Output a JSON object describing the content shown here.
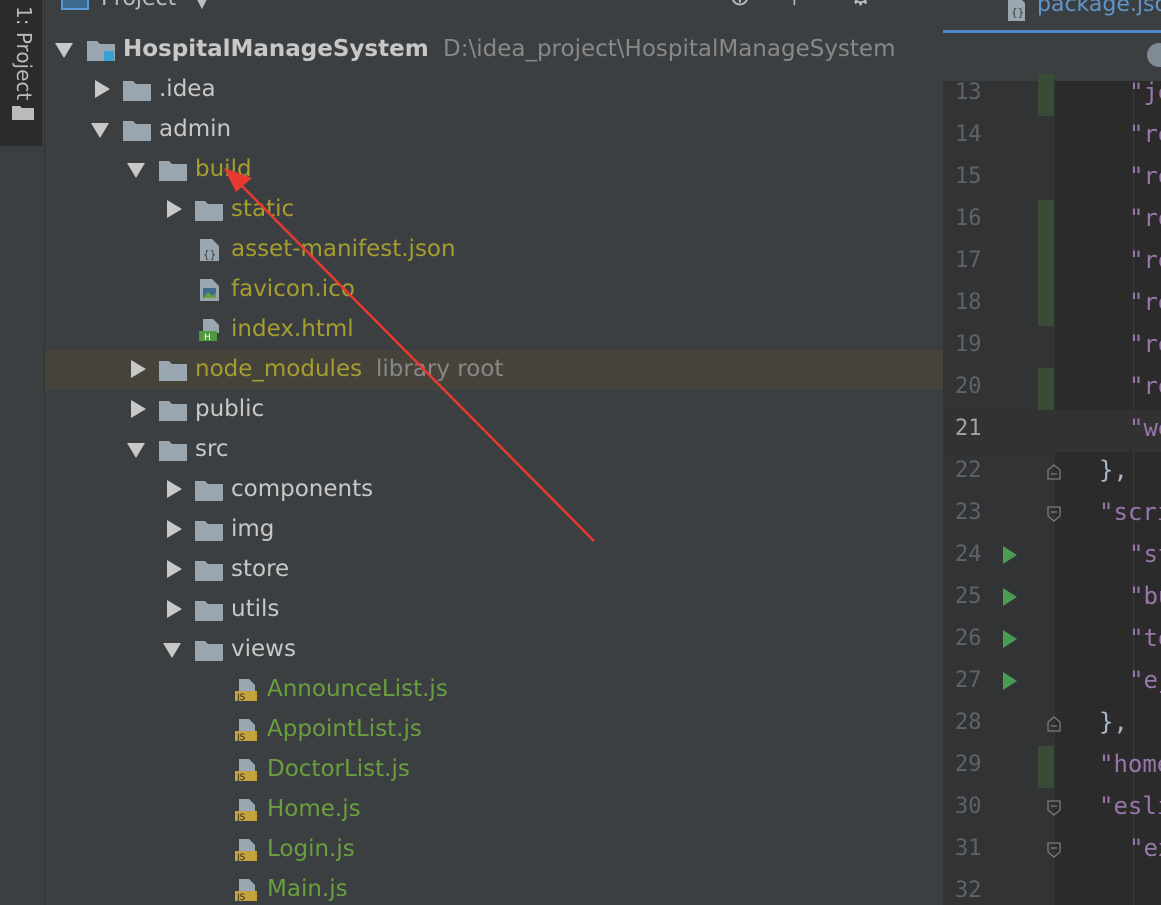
{
  "sidebar": {
    "tool_window_label": "1: Project"
  },
  "project_panel": {
    "title": "Project",
    "tree": [
      {
        "label": "HospitalManageSystem",
        "hint": "D:\\idea_project\\HospitalManageSystem",
        "kind": "module",
        "expanded": true,
        "color": "bold"
      },
      {
        "label": ".idea",
        "kind": "folder",
        "expanded": false,
        "color": "normal"
      },
      {
        "label": "admin",
        "kind": "folder",
        "expanded": true,
        "color": "normal"
      },
      {
        "label": "build",
        "kind": "folder",
        "expanded": true,
        "color": "ignored"
      },
      {
        "label": "static",
        "kind": "folder",
        "expanded": false,
        "color": "ignored"
      },
      {
        "label": "asset-manifest.json",
        "kind": "json-file",
        "color": "ignored"
      },
      {
        "label": "favicon.ico",
        "kind": "image-file",
        "color": "ignored"
      },
      {
        "label": "index.html",
        "kind": "html-file",
        "color": "ignored"
      },
      {
        "label": "node_modules",
        "hint": "library root",
        "kind": "folder",
        "expanded": false,
        "color": "ignored",
        "selected": true
      },
      {
        "label": "public",
        "kind": "folder",
        "expanded": false,
        "color": "normal"
      },
      {
        "label": "src",
        "kind": "folder",
        "expanded": true,
        "color": "normal"
      },
      {
        "label": "components",
        "kind": "folder",
        "expanded": false,
        "color": "normal"
      },
      {
        "label": "img",
        "kind": "folder",
        "expanded": false,
        "color": "normal"
      },
      {
        "label": "store",
        "kind": "folder",
        "expanded": false,
        "color": "normal"
      },
      {
        "label": "utils",
        "kind": "folder",
        "expanded": false,
        "color": "normal"
      },
      {
        "label": "views",
        "kind": "folder",
        "expanded": true,
        "color": "normal"
      },
      {
        "label": "AnnounceList.js",
        "kind": "js-file",
        "color": "added"
      },
      {
        "label": "AppointList.js",
        "kind": "js-file",
        "color": "added"
      },
      {
        "label": "DoctorList.js",
        "kind": "js-file",
        "color": "added"
      },
      {
        "label": "Home.js",
        "kind": "js-file",
        "color": "added"
      },
      {
        "label": "Login.js",
        "kind": "js-file",
        "color": "added"
      },
      {
        "label": "Main.js",
        "kind": "js-file",
        "color": "added"
      }
    ]
  },
  "editor": {
    "tab_label": "package.json",
    "current_line": 21,
    "lines": [
      {
        "n": "13",
        "code": "\"je",
        "changed": true
      },
      {
        "n": "14",
        "code": "\"re"
      },
      {
        "n": "15",
        "code": "\"re"
      },
      {
        "n": "16",
        "code": "\"re",
        "changed": true
      },
      {
        "n": "17",
        "code": "\"re",
        "changed": true
      },
      {
        "n": "18",
        "code": "\"re",
        "changed": true
      },
      {
        "n": "19",
        "code": "\"re"
      },
      {
        "n": "20",
        "code": "\"re",
        "changed": true
      },
      {
        "n": "21",
        "code": "\"we"
      },
      {
        "n": "22",
        "code": "},",
        "fold": "end"
      },
      {
        "n": "23",
        "code": "\"scri",
        "fold": "start"
      },
      {
        "n": "24",
        "code": "\"st",
        "run": true
      },
      {
        "n": "25",
        "code": "\"bu",
        "run": true
      },
      {
        "n": "26",
        "code": "\"te",
        "run": true
      },
      {
        "n": "27",
        "code": "\"ej",
        "run": true
      },
      {
        "n": "28",
        "code": "},",
        "fold": "end"
      },
      {
        "n": "29",
        "code": "\"home",
        "changed": true
      },
      {
        "n": "30",
        "code": "\"esli",
        "fold": "start"
      },
      {
        "n": "31",
        "code": "\"ex",
        "fold": "start"
      },
      {
        "n": "32",
        "code": ""
      }
    ]
  },
  "colors": {
    "ignored": "#a59e2f",
    "added": "#6a9f3e",
    "annotation_arrow": "#e8392f"
  }
}
